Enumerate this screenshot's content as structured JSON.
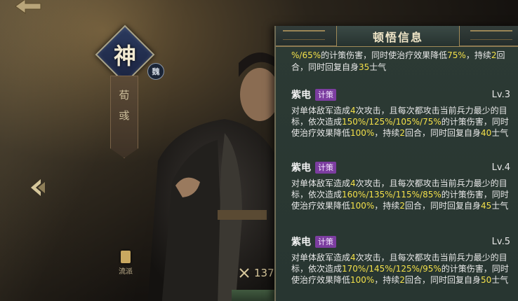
{
  "hero": {
    "badge_char": "神",
    "faction_char": "魏",
    "name_chars": [
      "荀",
      "彧"
    ],
    "faction_button_label": "流派",
    "power_value": "137"
  },
  "panel": {
    "title": "顿悟信息",
    "fragment": {
      "parts": [
        "%/65%",
        "的计策伤害，同时使治疗效果降低",
        "75%",
        "，持续",
        "2",
        "回合，同时回复自身",
        "35",
        "士气"
      ]
    },
    "skills": [
      {
        "name": "紫电",
        "tag": "计策",
        "level": "Lv.3",
        "parts": [
          "对单体敌军造成",
          "4",
          "次攻击，且每次都攻击当前兵力最少的目标，依次造成",
          "150%/125%/105%/75%",
          "的计策伤害，同时使治疗效果降低",
          "100%",
          "，持续",
          "2",
          "回合，同时回复自身",
          "40",
          "士气"
        ]
      },
      {
        "name": "紫电",
        "tag": "计策",
        "level": "Lv.4",
        "parts": [
          "对单体敌军造成",
          "4",
          "次攻击，且每次都攻击当前兵力最少的目标，依次造成",
          "160%/135%/115%/85%",
          "的计策伤害，同时使治疗效果降低",
          "100%",
          "，持续",
          "2",
          "回合，同时回复自身",
          "45",
          "士气"
        ]
      },
      {
        "name": "紫电",
        "tag": "计策",
        "level": "Lv.5",
        "parts": [
          "对单体敌军造成",
          "4",
          "次攻击，且每次都攻击当前兵力最少的目标，依次造成",
          "170%/145%/125%/95%",
          "的计策伤害，同时使治疗效果降低",
          "100%",
          "，持续",
          "2",
          "回合，同时回复自身",
          "50",
          "士气"
        ]
      }
    ]
  },
  "colors": {
    "highlight": "#f3e04a",
    "tag_bg": "#7c3da0",
    "panel_bg": "#2c3a34"
  }
}
